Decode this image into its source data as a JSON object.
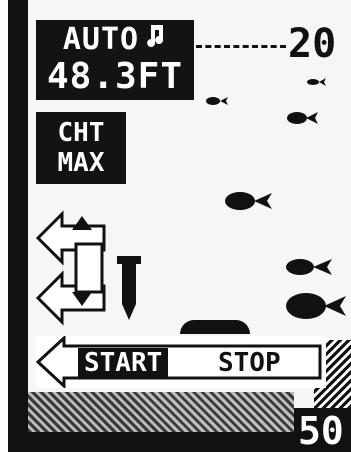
{
  "depth_panel": {
    "mode": "AUTO",
    "depth_value": "48.3FT",
    "fish_alarm_icon": "music-note-icon"
  },
  "chart_panel": {
    "line1": "CHT",
    "line2": "MAX"
  },
  "range": {
    "top": "20",
    "bottom": "50"
  },
  "controls": {
    "start_label": "START",
    "stop_label": "STOP",
    "up_icon": "triangle-up-icon",
    "down_icon": "triangle-down-icon",
    "left_arrow_icon": "left-arrow-icon"
  },
  "colors": {
    "lcd_dark": "#111111",
    "lcd_light": "#f6f6f6"
  }
}
